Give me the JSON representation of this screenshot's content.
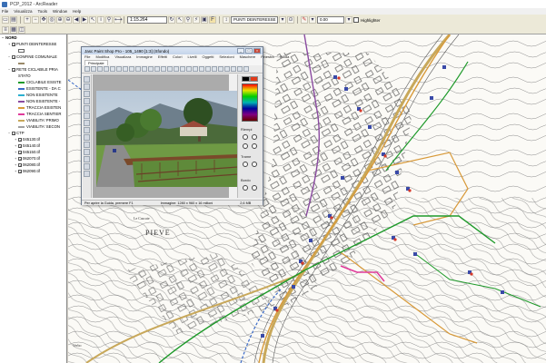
{
  "window": {
    "title": "PCP_2012 - ArcReader"
  },
  "menu": [
    "File",
    "Visualizza",
    "Tools",
    "Window",
    "Help"
  ],
  "toolbar": {
    "scale": "1:15.264",
    "layer": "PUNTI DEINTERESSE",
    "font_size": "0.00",
    "highlighter_label": "Highlighter"
  },
  "toc": {
    "items": [
      {
        "label": "NORD",
        "level": 0,
        "expander": "−",
        "checkbox": false,
        "bold": true
      },
      {
        "label": "PUNTI DEINTERESSE",
        "level": 1,
        "expander": "+",
        "checkbox": true
      },
      {
        "label": "",
        "level": 2,
        "expander": "",
        "checkbox": false,
        "swatch": "#ffffff"
      },
      {
        "label": "CONFINE COMUNALE",
        "level": 1,
        "expander": "−",
        "checkbox": true
      },
      {
        "label": "",
        "level": 2,
        "expander": "",
        "checkbox": false,
        "swatch": "#9a8a6a"
      },
      {
        "label": "RETE CICLABILE PRIA",
        "level": 1,
        "expander": "−",
        "checkbox": true
      },
      {
        "label": "STATO",
        "level": 2,
        "expander": "",
        "checkbox": false
      },
      {
        "label": "CICLABILE ESISTE",
        "level": 2,
        "expander": "",
        "checkbox": false,
        "swatch": "#1e9a2a"
      },
      {
        "label": "ESISTENTE - DA C",
        "level": 2,
        "expander": "",
        "checkbox": false,
        "swatch": "#3a6ac8"
      },
      {
        "label": "NON ESISTENTE",
        "level": 2,
        "expander": "",
        "checkbox": false,
        "swatch": "#2bb0d0"
      },
      {
        "label": "NON ESISTENTE -",
        "level": 2,
        "expander": "",
        "checkbox": false,
        "swatch": "#8a4aa0"
      },
      {
        "label": "TRACCIA ESISTEN",
        "level": 2,
        "expander": "",
        "checkbox": false,
        "swatch": "#d89a3a"
      },
      {
        "label": "TRACCIA SENTIER",
        "level": 2,
        "expander": "",
        "checkbox": false,
        "swatch": "#e03a9a"
      },
      {
        "label": "VIABILITA' PRIMO",
        "level": 2,
        "expander": "",
        "checkbox": false,
        "swatch": "#c8a85a"
      },
      {
        "label": "VIABILITA' SECON",
        "level": 2,
        "expander": "",
        "checkbox": false,
        "swatch": "#a0a0a0"
      },
      {
        "label": "CTP",
        "level": 1,
        "expander": "−",
        "checkbox": true
      },
      {
        "label": "045130.tif",
        "level": 2,
        "expander": "+",
        "checkbox": true
      },
      {
        "label": "045140.tif",
        "level": 2,
        "expander": "+",
        "checkbox": true
      },
      {
        "label": "045150.tif",
        "level": 2,
        "expander": "+",
        "checkbox": true
      },
      {
        "label": "062070.tif",
        "level": 2,
        "expander": "+",
        "checkbox": true
      },
      {
        "label": "062080.tif",
        "level": 2,
        "expander": "+",
        "checkbox": true
      },
      {
        "label": "062090.tif",
        "level": 2,
        "expander": "+",
        "checkbox": true
      }
    ]
  },
  "paintshop": {
    "title": "Jasc Paint Shop Pro - 105_1490 [1:3] (Sfondo)",
    "menu": [
      "File",
      "Modifica",
      "Visualizza",
      "Immagine",
      "Effetti",
      "Colori",
      "Livelli",
      "Oggetti",
      "Selezioni",
      "Maschere",
      "Finestra",
      "Guida"
    ],
    "tab": "Principale",
    "right_labels": {
      "fill": "Riempi",
      "texture": "Trame",
      "stroke": "Bordo"
    },
    "status_left": "Per aprire la Guida, premere F1",
    "status_mid": "Immagine: 1280 x 960 x 16 milioni",
    "status_right": "2,6 MB"
  },
  "map": {
    "place_label": "PIEVE",
    "small_labels": [
      "Le Cascate",
      "Verbo"
    ]
  },
  "colors": {
    "route_orange": "#d89a3a",
    "route_green": "#1e9a2a",
    "route_blue": "#3a6ac8",
    "route_purple": "#8a4aa0",
    "route_pink": "#e03a9a",
    "road_yellow": "#c8a85a"
  }
}
